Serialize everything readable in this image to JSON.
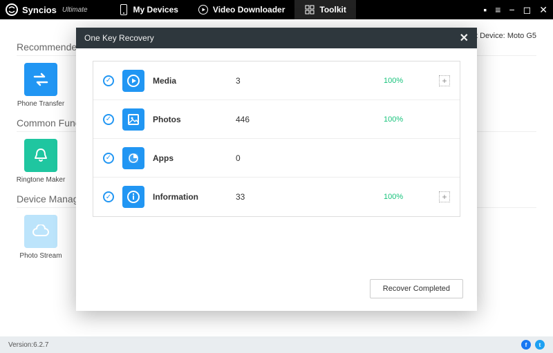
{
  "brand": {
    "name": "Syncios",
    "edition": "Ultimate"
  },
  "nav": {
    "devices": "My Devices",
    "downloader": "Video Downloader",
    "toolkit": "Toolkit"
  },
  "current_device_label": "Current Device: ",
  "current_device": "Moto G5",
  "sections": {
    "recommended": "Recommended",
    "common": "Common Functions",
    "device": "Device Management"
  },
  "tools": {
    "phone_transfer": "Phone Transfer",
    "ringtone_maker": "Ringtone Maker",
    "photo_stream": "Photo Stream"
  },
  "footer": {
    "version_label": "Version: ",
    "version": "6.2.7"
  },
  "modal": {
    "title": "One Key Recovery",
    "button": "Recover Completed",
    "rows": [
      {
        "name": "Media",
        "count": "3",
        "pct": "100%",
        "expand": true
      },
      {
        "name": "Photos",
        "count": "446",
        "pct": "100%",
        "expand": false
      },
      {
        "name": "Apps",
        "count": "0",
        "pct": "",
        "expand": false
      },
      {
        "name": "Information",
        "count": "33",
        "pct": "100%",
        "expand": true
      }
    ]
  }
}
